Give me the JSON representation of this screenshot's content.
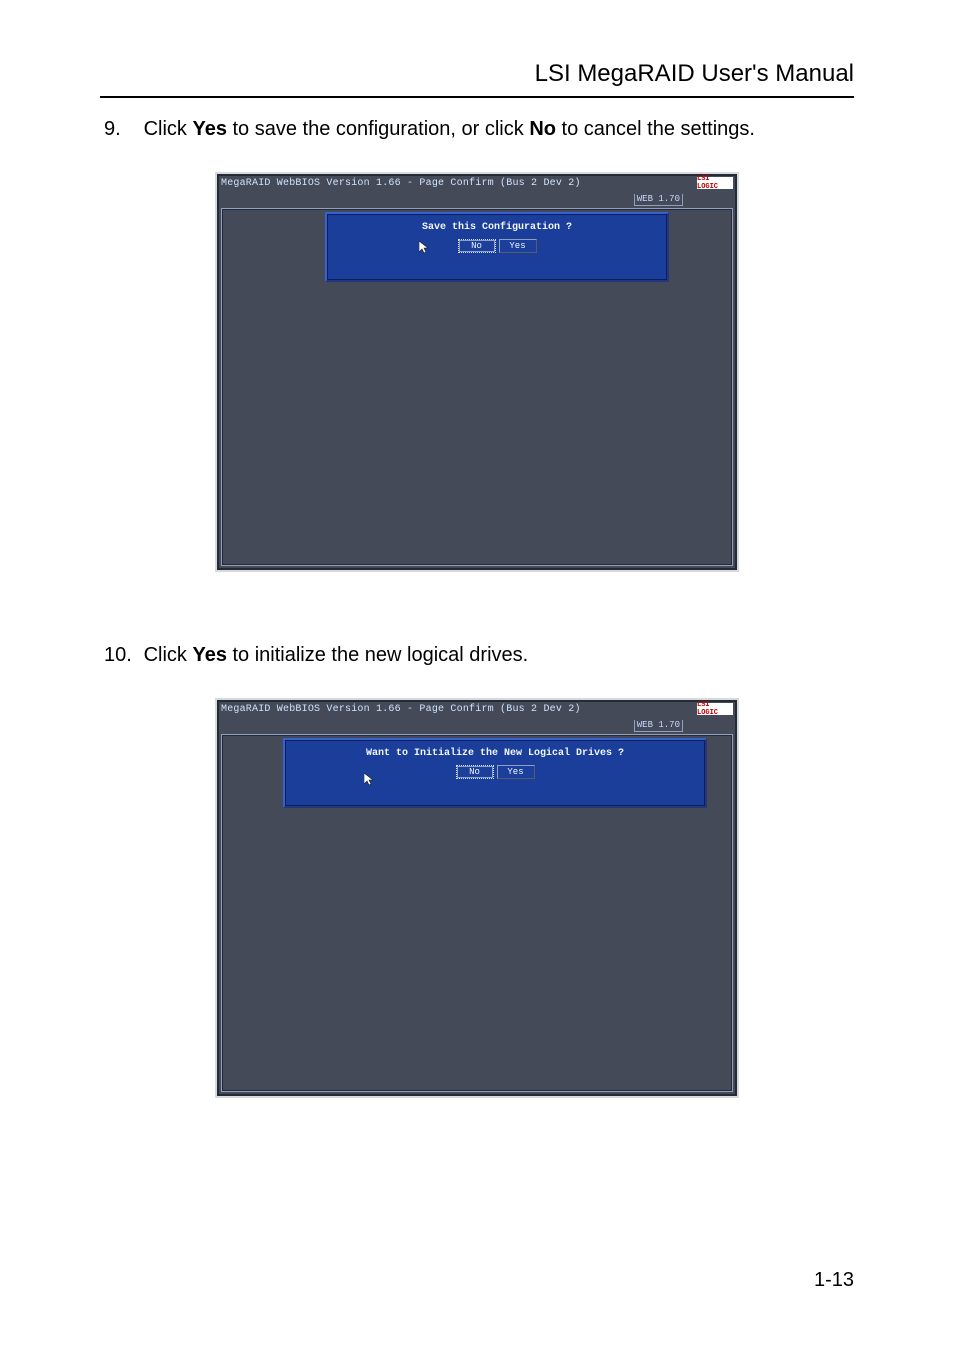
{
  "header": {
    "title": "LSI MegaRAID User's Manual"
  },
  "steps": {
    "s9": {
      "num": "9.",
      "pre": "Click ",
      "yes": "Yes",
      "mid": " to save the configuration, or click ",
      "no": "No",
      "post": " to cancel the settings."
    },
    "s10": {
      "num": "10.",
      "pre": "Click ",
      "yes": "Yes",
      "post": " to initialize the new logical drives."
    }
  },
  "screenshot1": {
    "title": "MegaRAID WebBIOS Version 1.66 - Page Confirm (Bus 2 Dev 2)",
    "logo": "LSI LOGIC",
    "tab": "WEB 1.70",
    "dialog_text": "Save this Configuration ?",
    "btn_no": "No",
    "btn_yes": "Yes"
  },
  "screenshot2": {
    "title": "MegaRAID WebBIOS Version 1.66 - Page Confirm (Bus 2 Dev 2)",
    "logo": "LSI LOGIC",
    "tab": "WEB 1.70",
    "dialog_text": "Want to Initialize the New Logical Drives ?",
    "btn_no": "No",
    "btn_yes": "Yes"
  },
  "footer": {
    "page": "1-13"
  }
}
